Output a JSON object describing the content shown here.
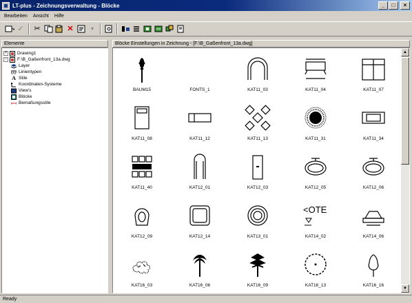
{
  "window": {
    "title": "LT-plus - Zeichnungsverwaltung - Blöcke",
    "ctrl_min": "_",
    "ctrl_max": "□",
    "ctrl_close": "×"
  },
  "menu": [
    "Bearbeiten",
    "Ansicht",
    "Hilfe"
  ],
  "left_panel": {
    "header": "Elemente",
    "tree": [
      {
        "label": "Drawing1",
        "icon": "drawing-icon",
        "indent": 0,
        "expander": "+"
      },
      {
        "label": "F:\\B_Gaßenfront_13a.dwg",
        "icon": "drawing-icon",
        "indent": 0,
        "expander": "−"
      },
      {
        "label": "Layer",
        "icon": "layer-icon",
        "indent": 1
      },
      {
        "label": "Linientypen",
        "icon": "linetype-icon",
        "indent": 1
      },
      {
        "label": "Stile",
        "icon": "text-style-icon",
        "indent": 1
      },
      {
        "label": "Koordinaten-Systeme",
        "icon": "ucs-icon",
        "indent": 1
      },
      {
        "label": "View's",
        "icon": "view-icon",
        "indent": 1
      },
      {
        "label": "Blöcke",
        "icon": "block-icon",
        "indent": 1
      },
      {
        "label": "Bemaßungsstile",
        "icon": "dimstyle-icon",
        "indent": 1
      }
    ]
  },
  "right_panel": {
    "header": "Blöcke Einstellungen in Zeichnung - [F:\\B_Gaßenfront_13a.dwg]",
    "blocks": [
      {
        "name": "BAUM15",
        "icon": "tree-icon"
      },
      {
        "name": "FONTS_1",
        "icon": "blank-icon"
      },
      {
        "name": "KAT11_03",
        "icon": "arch-icon"
      },
      {
        "name": "KAT11_04",
        "icon": "table-icon"
      },
      {
        "name": "KAT11_07",
        "icon": "window-icon"
      },
      {
        "name": "KAT11_08",
        "icon": "bed-icon"
      },
      {
        "name": "KAT11_12",
        "icon": "bench-icon"
      },
      {
        "name": "KAT11_13",
        "icon": "chairs-x-icon"
      },
      {
        "name": "KAT11_31",
        "icon": "radial-plant-icon"
      },
      {
        "name": "KAT11_34",
        "icon": "sofa-icon"
      },
      {
        "name": "KAT11_40",
        "icon": "seating-group-icon"
      },
      {
        "name": "KAT12_01",
        "icon": "door-icon"
      },
      {
        "name": "KAT12_03",
        "icon": "door-handle-icon"
      },
      {
        "name": "KAT12_05",
        "icon": "basin-icon"
      },
      {
        "name": "KAT12_06",
        "icon": "basin-icon"
      },
      {
        "name": "KAT12_09",
        "icon": "toilet-icon"
      },
      {
        "name": "KAT12_14",
        "icon": "square-basin-icon"
      },
      {
        "name": "KAT13_01",
        "icon": "rings-icon"
      },
      {
        "name": "KAT14_02",
        "icon": "note-icon"
      },
      {
        "name": "KAT14_06",
        "icon": "car-icon"
      },
      {
        "name": "KAT16_03",
        "icon": "shrub-icon"
      },
      {
        "name": "KAT16_06",
        "icon": "palm-icon"
      },
      {
        "name": "KAT16_09",
        "icon": "conifer-icon"
      },
      {
        "name": "KAT16_13",
        "icon": "circle-tree-icon"
      },
      {
        "name": "KAT16_16",
        "icon": "small-tree-icon"
      }
    ],
    "note_text": "<OTE"
  },
  "status": "Ready"
}
